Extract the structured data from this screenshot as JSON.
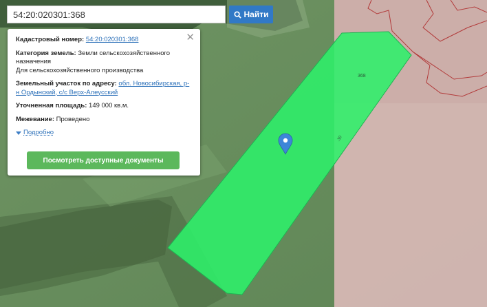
{
  "search": {
    "value": "54:20:020301:368",
    "button_label": "Найти",
    "icon": "search-icon"
  },
  "map": {
    "parcel_label": "368",
    "parcel_color": "#2ef06a",
    "boundary_color": "#b23a3a",
    "marker_icon": "map-pin-icon",
    "marker_color": "#3d86d8"
  },
  "popup": {
    "close_icon": "close-icon",
    "cadastral_label": "Кадастровый номер:",
    "cadastral_value": "54:20:020301:368",
    "category_label": "Категория земель:",
    "category_value": "Земли сельскохозяйственного назначения",
    "use_value": "Для сельскохозяйственного производства",
    "address_label": "Земельный участок по адресу:",
    "address_value": "обл. Новосибирская, р-н Ордынский, с/с Верх-Алеусский",
    "area_label": "Уточненная площадь:",
    "area_value": "149 000 кв.м.",
    "survey_label": "Межевание:",
    "survey_value": "Проведено",
    "details_label": "Подробно",
    "docs_button": "Посмотреть доступные документы"
  }
}
